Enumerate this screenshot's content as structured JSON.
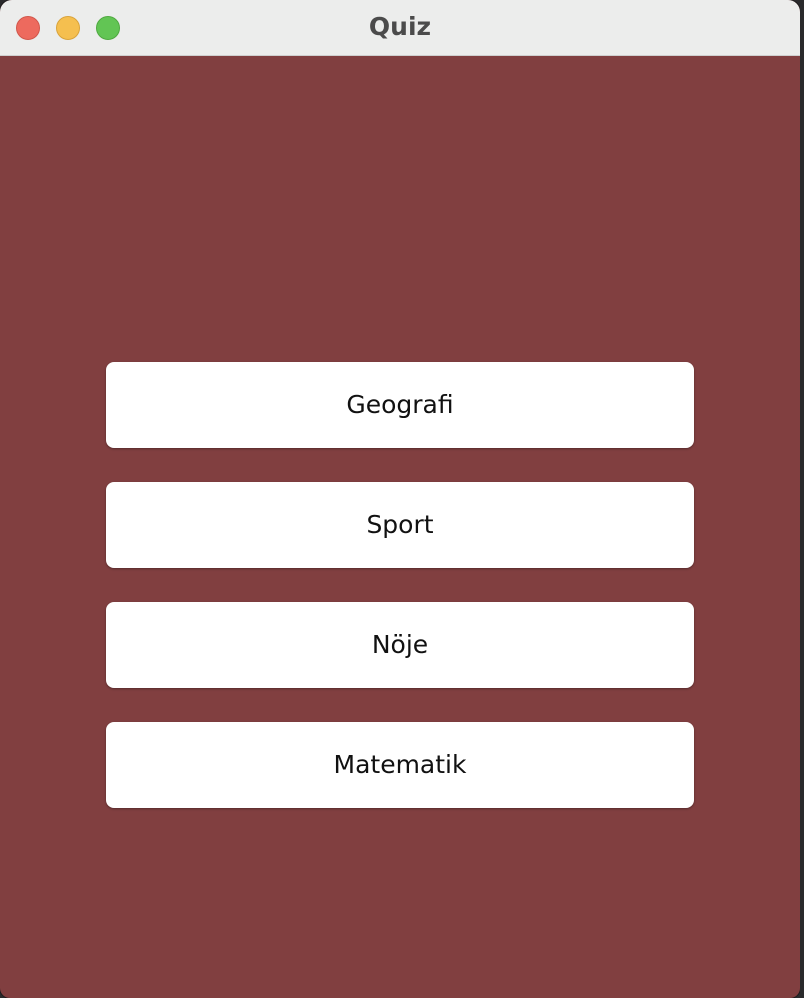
{
  "window": {
    "title": "Quiz",
    "background_color": "#813f40"
  },
  "titlebar": {
    "controls": [
      "close",
      "minimize",
      "zoom"
    ]
  },
  "categories": [
    {
      "label": "Geografi"
    },
    {
      "label": "Sport"
    },
    {
      "label": "Nöje"
    },
    {
      "label": "Matematik"
    }
  ]
}
